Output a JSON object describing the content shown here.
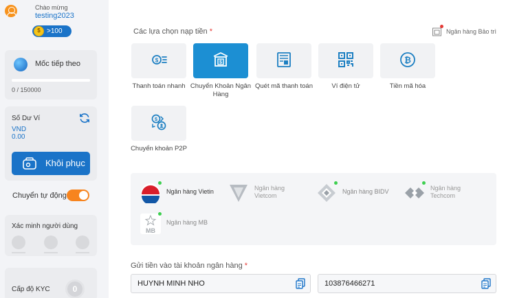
{
  "user": {
    "welcome": "Chào mừng",
    "username": "testing2023",
    "points": ">100"
  },
  "milestone": {
    "label": "Mốc tiếp theo",
    "progress_value": "0 / 150000",
    "progress_fraction": 0
  },
  "balance": {
    "label": "Số Dư Ví",
    "currency": "VND",
    "amount": "0.00",
    "restore_label": "Khôi phục"
  },
  "auto_transfer": {
    "label": "Chuyển tự động",
    "enabled": true
  },
  "verification": {
    "label": "Xác minh người dùng"
  },
  "kyc": {
    "label": "Cấp độ KYC",
    "level": "0"
  },
  "deposit": {
    "title": "Các lựa chọn nạp tiền",
    "required_mark": "*",
    "maintenance_label": "Ngân hàng Bảo trì",
    "methods": [
      {
        "label": "Thanh toán nhanh",
        "icon": "fast-payment-icon",
        "active": false
      },
      {
        "label": "Chuyển Khoản Ngân Hàng",
        "icon": "bank-transfer-icon",
        "active": true
      },
      {
        "label": "Quét mã thanh toán",
        "icon": "scan-code-icon",
        "active": false
      },
      {
        "label": "Ví điện tử",
        "icon": "qr-wallet-icon",
        "active": false
      },
      {
        "label": "Tiền mã hóa",
        "icon": "bitcoin-icon",
        "active": false
      },
      {
        "label": "Chuyển khoản P2P",
        "icon": "p2p-exchange-icon",
        "active": false
      }
    ],
    "banks": [
      {
        "name": "Ngân hàng Vietin",
        "available": true
      },
      {
        "name": "Ngân hàng Vietcom",
        "available": false
      },
      {
        "name": "Ngân hàng BIDV",
        "available": true
      },
      {
        "name": "Ngân hàng Techcom",
        "available": true
      },
      {
        "name": "Ngân hàng MB",
        "available": true
      }
    ],
    "bank_account_label": "Gửi tiền vào tài khoản ngân hàng",
    "account_name": "HUYNH MINH NHO",
    "account_number": "103876466271"
  },
  "colors": {
    "primary": "#1a73c8",
    "active_method": "#1c8fd3",
    "toggle": "#f7841e",
    "status_ok": "#3ccf4e",
    "required": "#e53935"
  }
}
